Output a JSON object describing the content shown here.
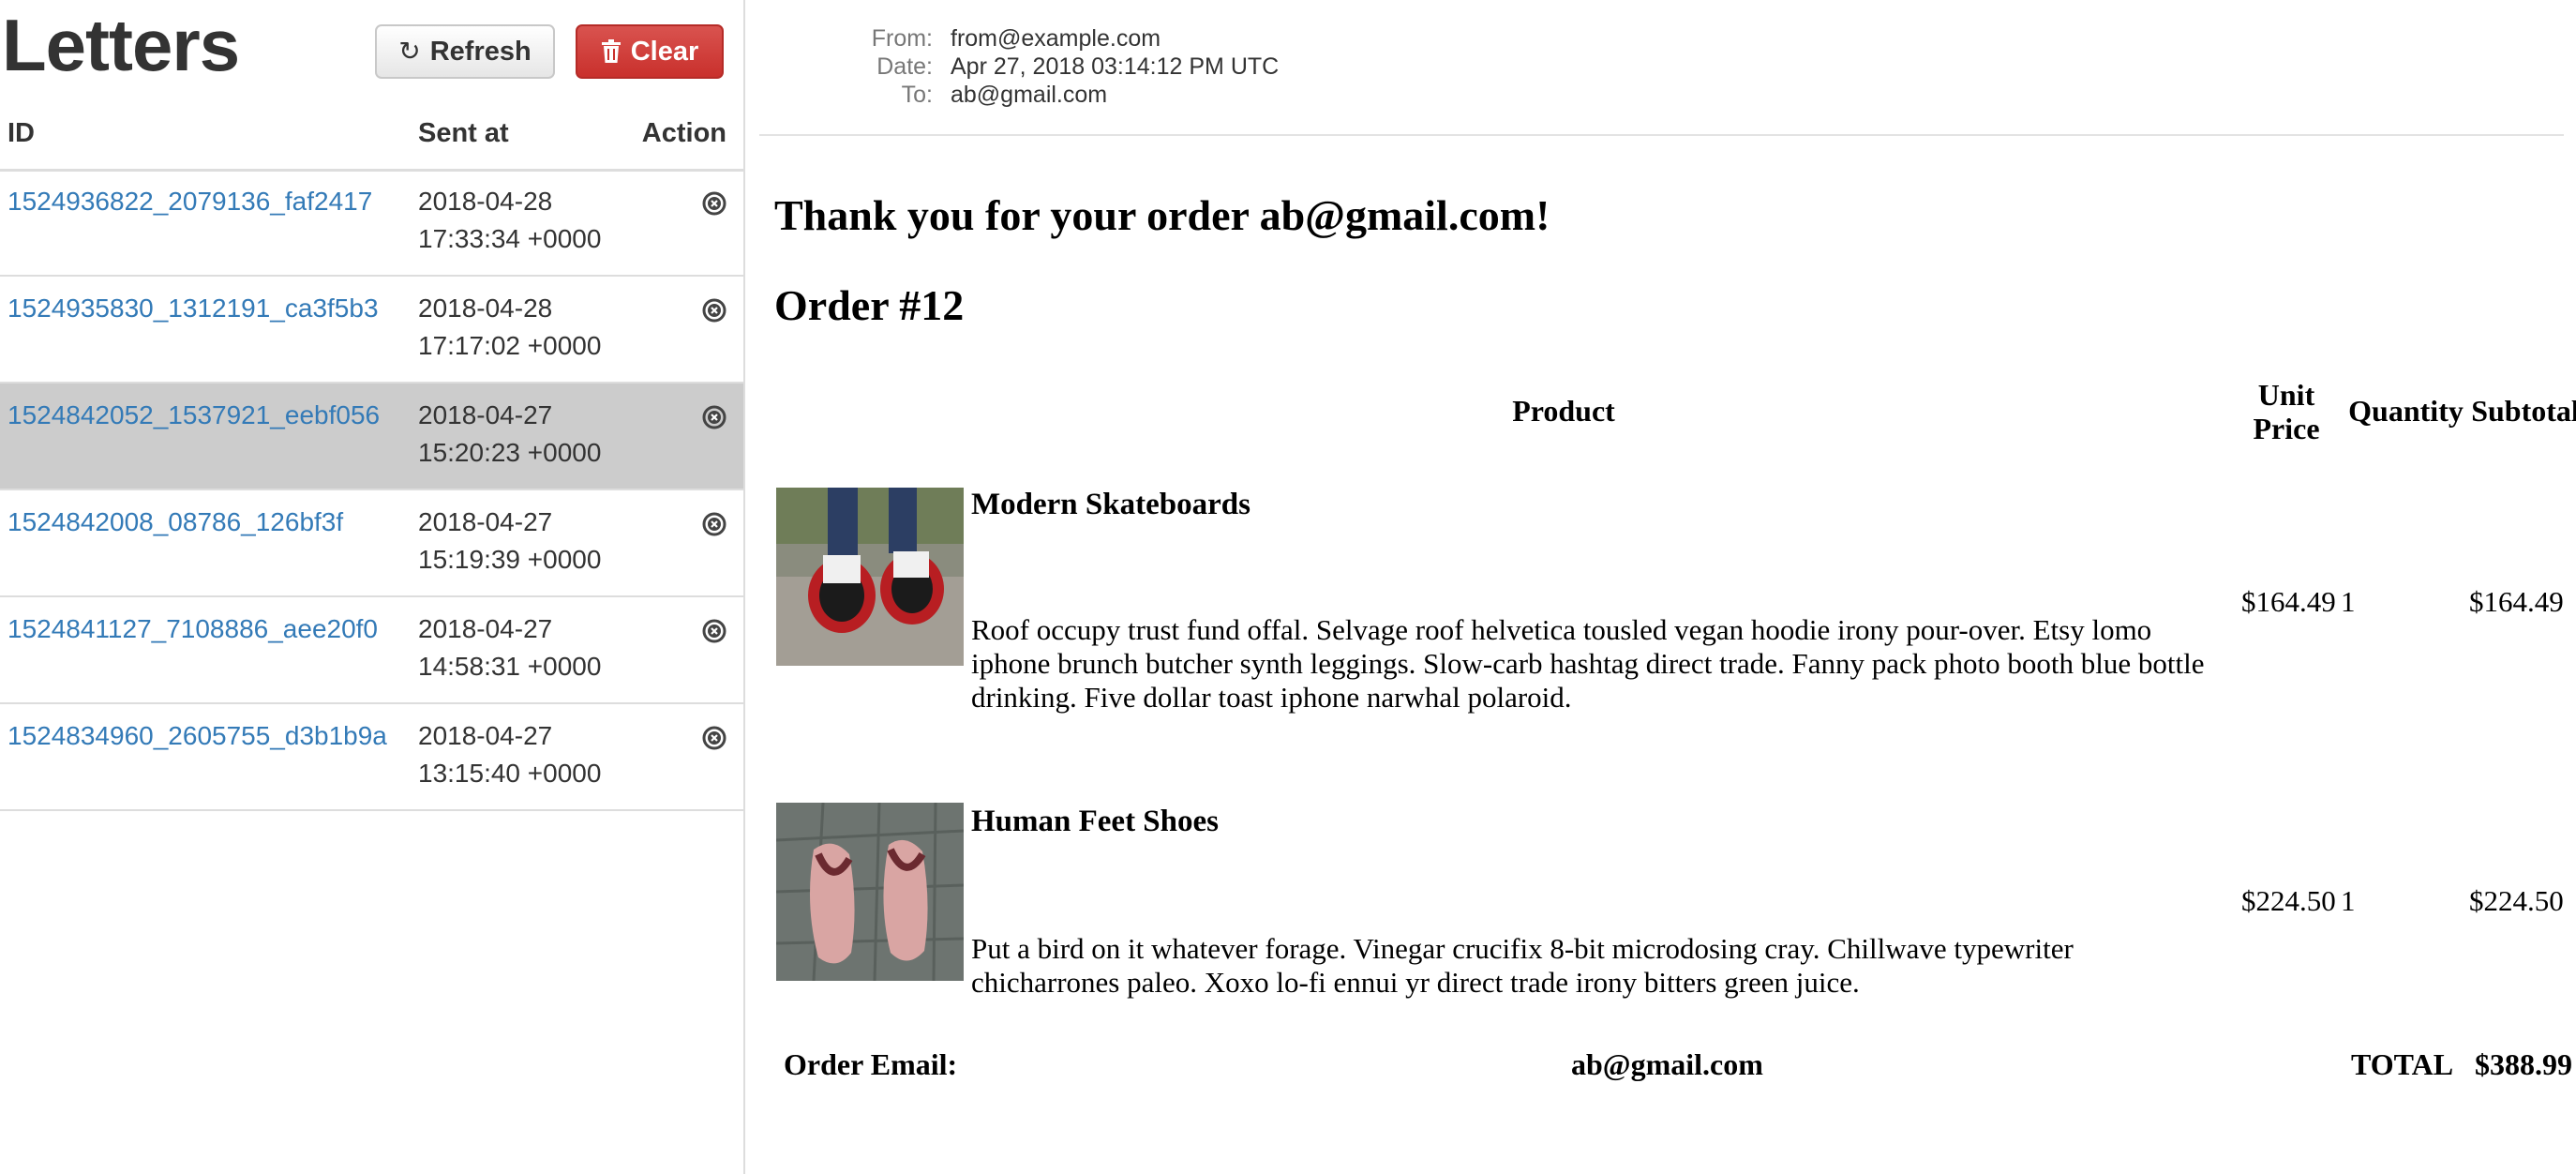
{
  "sidebar": {
    "title": "Letters",
    "refresh_label": "Refresh",
    "clear_label": "Clear",
    "columns": {
      "id": "ID",
      "sent_at": "Sent at",
      "action": "Action"
    },
    "letters": [
      {
        "id": "1524936822_2079136_faf2417",
        "date": "2018-04-28",
        "time": "17:33:34 +0000"
      },
      {
        "id": "1524935830_1312191_ca3f5b3",
        "date": "2018-04-28",
        "time": "17:17:02 +0000"
      },
      {
        "id": "1524842052_1537921_eebf056",
        "date": "2018-04-27",
        "time": "15:20:23 +0000"
      },
      {
        "id": "1524842008_08786_126bf3f",
        "date": "2018-04-27",
        "time": "15:19:39 +0000"
      },
      {
        "id": "1524841127_7108886_aee20f0",
        "date": "2018-04-27",
        "time": "14:58:31 +0000"
      },
      {
        "id": "1524834960_2605755_d3b1b9a",
        "date": "2018-04-27",
        "time": "13:15:40 +0000"
      }
    ],
    "selected_index": 2
  },
  "message": {
    "headers": {
      "from_label": "From:",
      "from": "from@example.com",
      "date_label": "Date:",
      "date": "Apr 27, 2018 03:14:12 PM UTC",
      "to_label": "To:",
      "to": "ab@gmail.com"
    },
    "heading": "Thank you for your order ab@gmail.com!",
    "order_title": "Order #12",
    "table_headers": {
      "product": "Product",
      "unit_price_1": "Unit",
      "unit_price_2": "Price",
      "quantity": "Quantity",
      "subtotal": "Subtotal"
    },
    "items": [
      {
        "name": "Modern Skateboards",
        "description": "Roof occupy trust fund offal. Selvage roof helvetica tousled vegan hoodie irony pour-over. Etsy lomo iphone brunch butcher synth leggings. Slow-carb hashtag direct trade. Fanny pack photo booth blue bottle drinking. Five dollar toast iphone narwhal polaroid.",
        "unit_price": "$164.49",
        "quantity": "1",
        "subtotal": "$164.49"
      },
      {
        "name": "Human Feet Shoes",
        "description": "Put a bird on it whatever forage. Vinegar crucifix 8-bit microdosing cray. Chillwave typewriter chicharrones paleo. Xoxo lo-fi ennui yr direct trade irony bitters green juice.",
        "unit_price": "$224.50",
        "quantity": "1",
        "subtotal": "$224.50"
      }
    ],
    "footer": {
      "order_email_label": "Order Email:",
      "order_email": "ab@gmail.com",
      "total_label": "TOTAL",
      "total": "$388.99"
    }
  },
  "colors": {
    "link": "#337ab7",
    "danger": "#d9534f",
    "selected_row": "#cccccc"
  }
}
